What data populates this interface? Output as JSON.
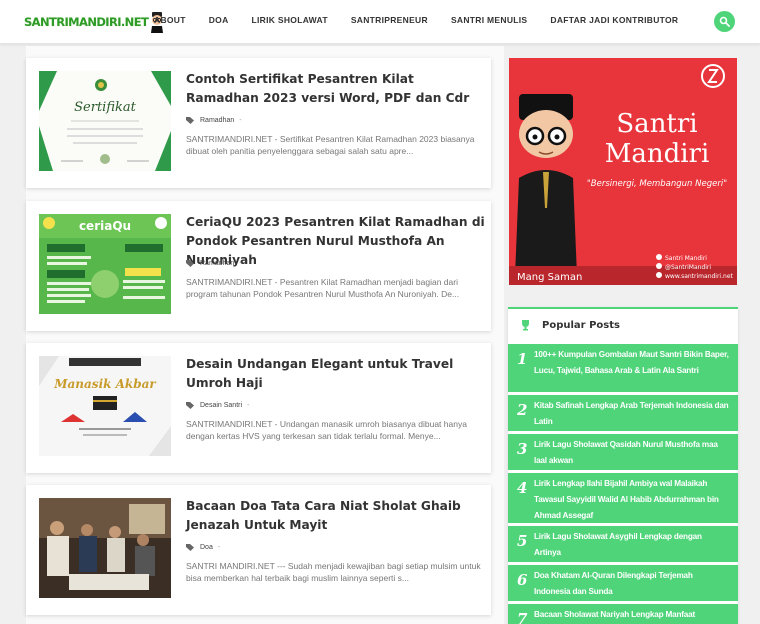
{
  "header": {
    "logo_text": "SANTRIMANDIRI.NET",
    "nav": [
      "ABOUT",
      "DOA",
      "LIRIK SHOLAWAT",
      "SANTRIPRENEUR",
      "SANTRI MENULIS",
      "DAFTAR JADI KONTRIBUTOR"
    ]
  },
  "posts": [
    {
      "title": "Contoh Sertifikat Pesantren Kilat Ramadhan 2023 versi Word, PDF dan Cdr",
      "label": "Ramadhan",
      "excerpt": "SANTRIMANDIRI.NET - Sertifikat Pesantren Kilat Ramadhan 2023 biasanya dibuat oleh panitia penyelenggara sebagai salah satu apre...",
      "thumb_text": "Sertifikat"
    },
    {
      "title": "CeriaQU 2023 Pesantren Kilat Ramadhan di Pondok Pesantren Nurul Musthofa An Nuroniyah",
      "label": "Ramadhan",
      "excerpt": "SANTRIMANDIRI.NET - Pesantren Kilat Ramadhan menjadi bagian dari program tahunan Pondok Pesantren Nurul Musthofa An Nuroniyah. De...",
      "thumb_text": "ceriaQu"
    },
    {
      "title": "Desain Undangan Elegant untuk Travel Umroh Haji",
      "label": "Desain Santri",
      "excerpt": "SANTRIMANDIRI.NET - Undangan manasik umroh biasanya dibuat hanya dengan kertas HVS yang terkesan san tidak terlalu formal. Menye...",
      "thumb_text": "Manasik Akbar"
    },
    {
      "title": "Bacaan Doa Tata Cara Niat Sholat Ghaib Jenazah Untuk Mayit",
      "label": "Doa",
      "excerpt": "SANTRI MANDIRI.NET --- Sudah menjadi kewajiban bagi setiap mulsim untuk bisa memberkan hal terbaik bagi muslim lainnya seperti s..."
    }
  ],
  "sidebar": {
    "ad": {
      "brand_line1": "Santri",
      "brand_line2": "Mandiri",
      "tagline": "\"Bersinergi, Membangun Negeri\"",
      "character_name": "Mang Saman",
      "contacts": [
        "Santri Mandiri",
        "@SantriMandiri",
        "www.santrimandiri.net"
      ]
    },
    "popular_title": "Popular Posts",
    "popular_posts": [
      {
        "num": "1",
        "title": "100++ Kumpulan Gombalan Maut Santri Bikin Baper, Lucu, Tajwid, Bahasa Arab & Latin Ala Santri"
      },
      {
        "num": "2",
        "title": "Kitab Safinah Lengkap Arab Terjemah Indonesia dan Latin"
      },
      {
        "num": "3",
        "title": "Lirik Lagu Sholawat Qasidah Nurul Musthofa maa laal akwan"
      },
      {
        "num": "4",
        "title": "Lirik Lengkap Ilahi Bijahil Ambiya wal Malaikah Tawasul Sayyidil Walid Al Habib Abdurrahman bin Ahmad Assegaf"
      },
      {
        "num": "5",
        "title": "Lirik Lagu Sholawat Asyghil Lengkap dengan Artinya"
      },
      {
        "num": "6",
        "title": "Doa Khatam Al-Quran Dilengkapi Terjemah Indonesia dan Sunda"
      },
      {
        "num": "7",
        "title": "Bacaan Sholawat Nariyah Lengkap Manfaat"
      }
    ]
  },
  "colors": {
    "accent": "#4fd47a",
    "ad_red": "#e8343b",
    "logo_green": "#2e9a27"
  }
}
